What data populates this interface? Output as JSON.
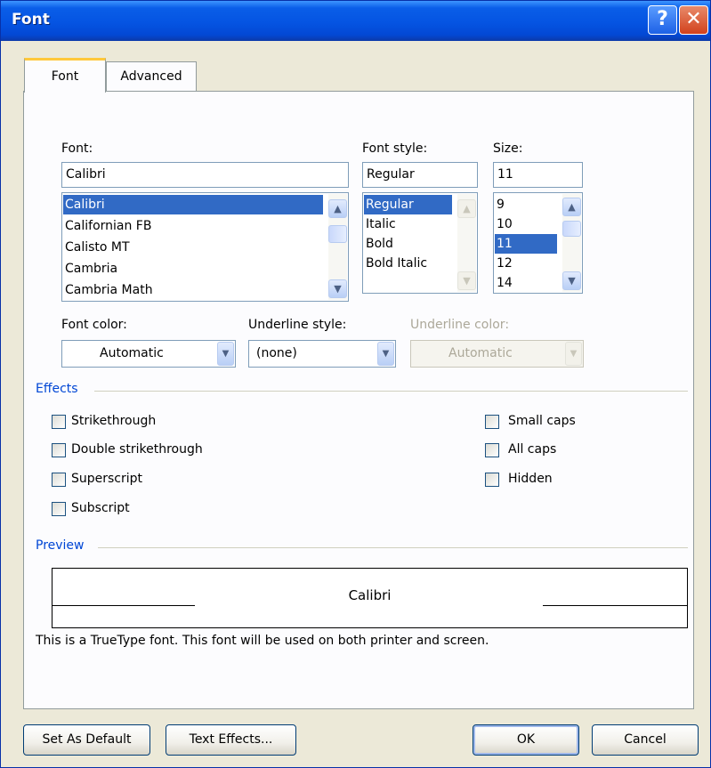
{
  "window": {
    "title": "Font",
    "help_label": "?",
    "close_label": "✕"
  },
  "tabs": [
    {
      "label": "Font",
      "active": true
    },
    {
      "label": "Advanced",
      "active": false
    }
  ],
  "font": {
    "label": "Font:",
    "value": "Calibri",
    "items": [
      "Calibri",
      "Californian FB",
      "Calisto MT",
      "Cambria",
      "Cambria Math"
    ],
    "selected": "Calibri"
  },
  "font_style": {
    "label": "Font style:",
    "value": "Regular",
    "items": [
      "Regular",
      "Italic",
      "Bold",
      "Bold Italic"
    ],
    "selected": "Regular"
  },
  "size": {
    "label": "Size:",
    "value": "11",
    "items": [
      "9",
      "10",
      "11",
      "12",
      "14"
    ],
    "selected": "11"
  },
  "font_color": {
    "label": "Font color:",
    "value": "Automatic"
  },
  "underline_style": {
    "label": "Underline style:",
    "value": "(none)"
  },
  "underline_color": {
    "label": "Underline color:",
    "value": "Automatic",
    "disabled": true
  },
  "effects": {
    "title": "Effects",
    "left": [
      {
        "label": "Strikethrough",
        "checked": false
      },
      {
        "label": "Double strikethrough",
        "checked": false
      },
      {
        "label": "Superscript",
        "checked": false
      },
      {
        "label": "Subscript",
        "checked": false
      }
    ],
    "right": [
      {
        "label": "Small caps",
        "checked": false
      },
      {
        "label": "All caps",
        "checked": false
      },
      {
        "label": "Hidden",
        "checked": false
      }
    ]
  },
  "preview": {
    "title": "Preview",
    "sample": "Calibri",
    "note": "This is a TrueType font. This font will be used on both printer and screen."
  },
  "buttons": {
    "set_default": "Set As Default",
    "text_effects": "Text Effects...",
    "ok": "OK",
    "cancel": "Cancel"
  },
  "icons": {
    "scroll_up": "chevron-up-icon",
    "scroll_down": "chevron-down-icon",
    "dropdown": "chevron-down-icon"
  },
  "colors": {
    "title_bar": "#0554e2",
    "selection": "#316ac5",
    "group_title": "#0046d5",
    "dialog_bg": "#ece9d8"
  }
}
